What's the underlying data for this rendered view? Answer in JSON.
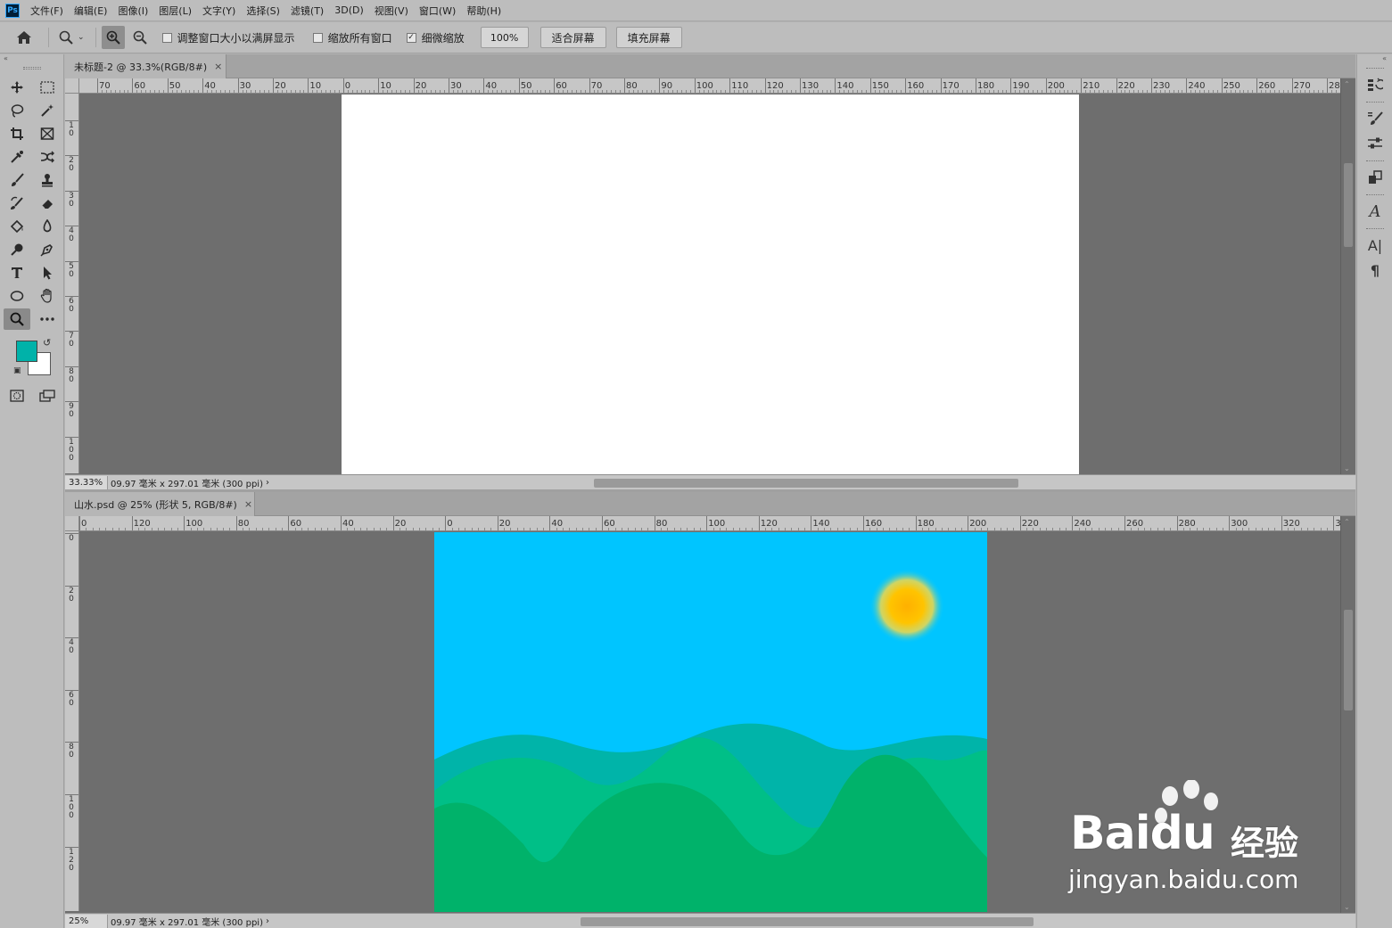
{
  "app": {
    "logo": "Ps"
  },
  "menu": [
    "文件(F)",
    "编辑(E)",
    "图像(I)",
    "图层(L)",
    "文字(Y)",
    "选择(S)",
    "滤镜(T)",
    "3D(D)",
    "视图(V)",
    "窗口(W)",
    "帮助(H)"
  ],
  "options": {
    "resize_windows_label": "调整窗口大小以满屏显示",
    "zoom_all_label": "缩放所有窗口",
    "scrubby_zoom_label": "细微缩放",
    "zoom_value": "100%",
    "fit_screen_label": "适合屏幕",
    "fill_screen_label": "填充屏幕"
  },
  "icons": {
    "home": "home-icon",
    "zoom_tool": "magnifier-icon",
    "zoom_in": "zoom-in-icon",
    "zoom_out": "zoom-out-icon"
  },
  "colors": {
    "foreground": "#00b2a9",
    "background": "#ffffff",
    "sky": "#00c5ff",
    "sun": "#ffb800"
  },
  "doc1": {
    "tab_title": "未标题-2 @ 33.3%(RGB/8#)",
    "close": "×",
    "zoom": "33.33%",
    "info": "09.97 毫米 x 297.01 毫米 (300 ppi)",
    "info_arrow": "›",
    "ruler_h": [
      "70",
      "60",
      "50",
      "40",
      "30",
      "20",
      "10",
      "0",
      "10",
      "20",
      "30",
      "40",
      "50",
      "60",
      "70",
      "80",
      "90",
      "100",
      "110",
      "120",
      "130",
      "140",
      "150",
      "160",
      "170",
      "180",
      "190",
      "200",
      "210",
      "220",
      "230",
      "240",
      "250",
      "260",
      "270",
      "28"
    ],
    "ruler_v": [
      "1\n0",
      "2\n0",
      "3\n0",
      "4\n0",
      "5\n0",
      "6\n0",
      "7\n0",
      "8\n0",
      "9\n0",
      "1\n0\n0"
    ]
  },
  "doc2": {
    "tab_title": "山水.psd @ 25% (形状 5, RGB/8#)",
    "close": "×",
    "zoom": "25%",
    "info": "09.97 毫米 x 297.01 毫米 (300 ppi)",
    "info_arrow": "›",
    "ruler_h": [
      "0",
      "120",
      "100",
      "80",
      "60",
      "40",
      "20",
      "0",
      "20",
      "40",
      "60",
      "80",
      "100",
      "120",
      "140",
      "160",
      "180",
      "200",
      "220",
      "240",
      "260",
      "280",
      "300",
      "320",
      "3"
    ],
    "ruler_v": [
      "0",
      "2\n0",
      "4\n0",
      "6\n0",
      "8\n0",
      "1\n0\n0",
      "1\n2\n0"
    ]
  },
  "watermark": {
    "brand": "Bai",
    "brand2": "du",
    "cn": "经验",
    "url": "jingyan.baidu.com"
  }
}
